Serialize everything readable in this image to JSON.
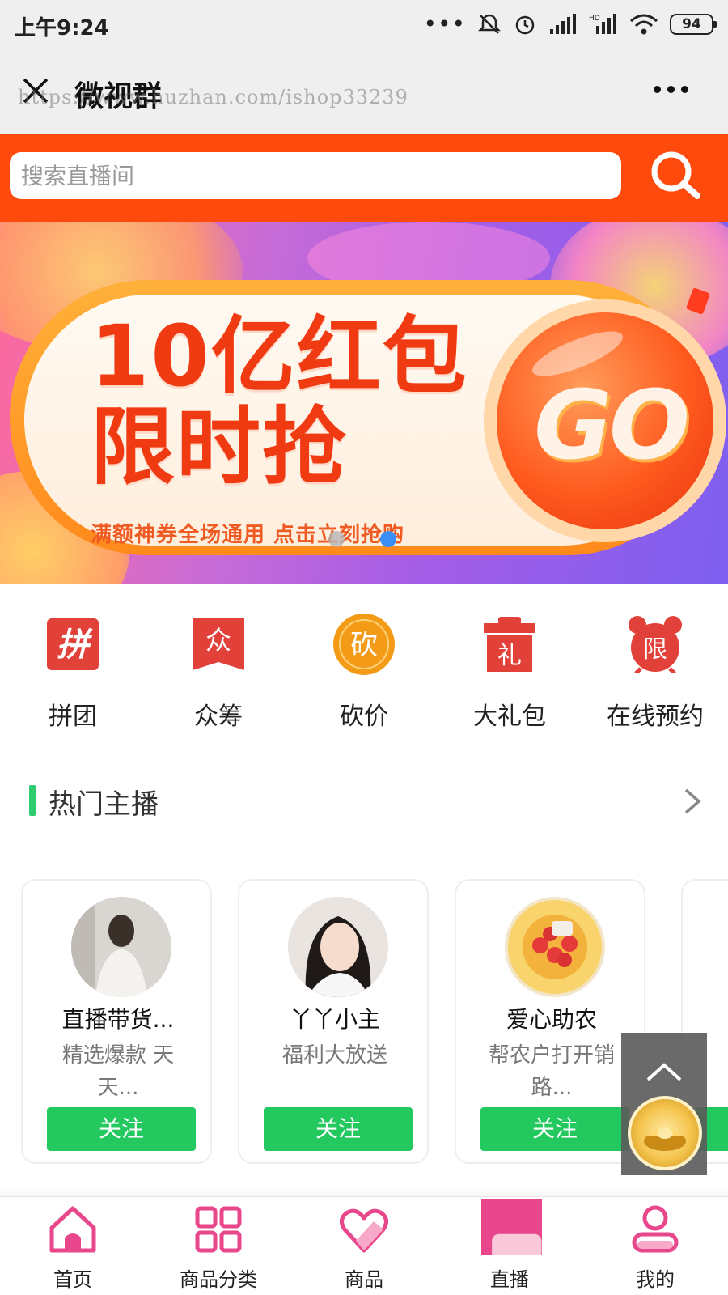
{
  "status_bar": {
    "time": "上午9:24",
    "battery": "94",
    "dots": "•••"
  },
  "title_bar": {
    "title": "微视群",
    "watermark": "https://www.huzhan.com/ishop33239"
  },
  "search": {
    "placeholder": "搜索直播间"
  },
  "banner": {
    "title_line1": "10亿红包",
    "title_line2": "限时抢",
    "subtitle": "满额神券全场通用 点击立刻抢购",
    "go_text": "GO",
    "slides_total": 2,
    "active_slide": 2
  },
  "quick_menu": [
    {
      "label": "拼团",
      "icon": "pin-group-icon",
      "glyph": "拼"
    },
    {
      "label": "众筹",
      "icon": "crowdfunding-icon",
      "glyph": "众"
    },
    {
      "label": "砍价",
      "icon": "bargain-icon",
      "glyph": "砍"
    },
    {
      "label": "大礼包",
      "icon": "gift-package-icon",
      "glyph": "礼"
    },
    {
      "label": "在线预约",
      "icon": "appointment-alarm-icon",
      "glyph": "限"
    }
  ],
  "hot_anchors": {
    "title": "热门主播",
    "cards": [
      {
        "name": "直播带货...",
        "desc": "精选爆款 天天...",
        "follow": "关注"
      },
      {
        "name": "丫丫小主",
        "desc": "福利大放送",
        "follow": "关注"
      },
      {
        "name": "爱心助农",
        "desc": "帮农户打开销路...",
        "follow": "关注"
      }
    ]
  },
  "tab_bar": [
    {
      "label": "首页",
      "icon": "home-icon"
    },
    {
      "label": "商品分类",
      "icon": "category-grid-icon"
    },
    {
      "label": "商品",
      "icon": "heart-icon"
    },
    {
      "label": "直播",
      "icon": "live-icon"
    },
    {
      "label": "我的",
      "icon": "user-icon"
    }
  ],
  "colors": {
    "accent_orange": "#ff4a0d",
    "follow_green": "#23c95f",
    "section_green": "#2ecc71",
    "tab_pink": "#e8478b",
    "icon_red": "#e2413a",
    "icon_orange": "#f39b16"
  }
}
